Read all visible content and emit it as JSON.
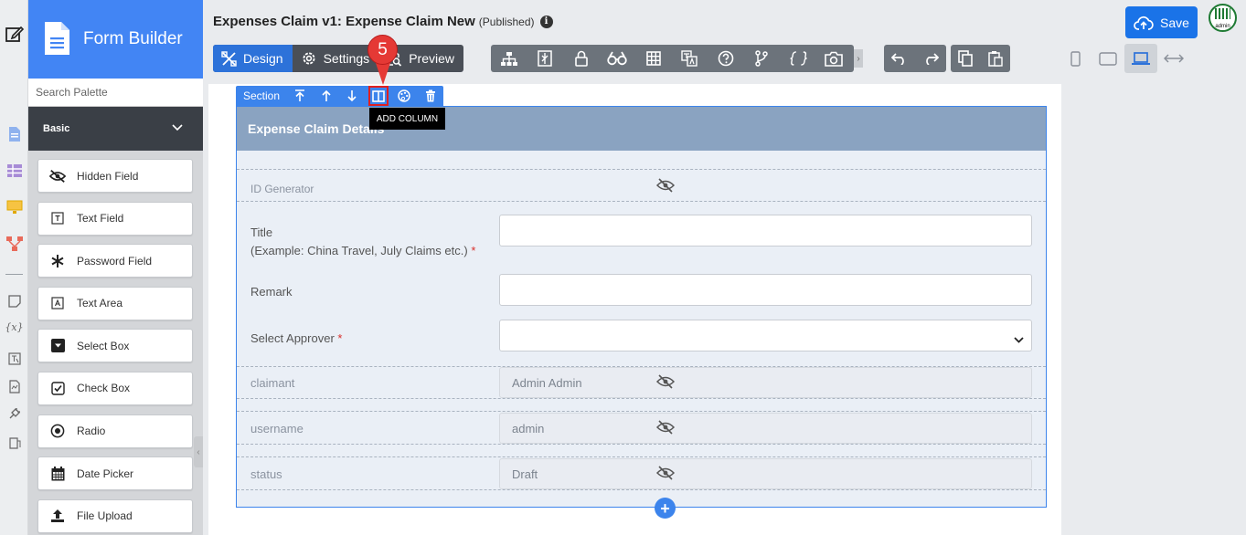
{
  "app": {
    "title": "Expenses Claim v1: Expense Claim New",
    "status": "(Published)"
  },
  "palette": {
    "title": "Form Builder",
    "search_placeholder": "Search Palette",
    "category": "Basic",
    "items": [
      {
        "label": "Hidden Field",
        "icon": "eye-slash-icon"
      },
      {
        "label": "Text Field",
        "icon": "text-field-icon"
      },
      {
        "label": "Password Field",
        "icon": "asterisk-icon"
      },
      {
        "label": "Text Area",
        "icon": "text-area-icon"
      },
      {
        "label": "Select Box",
        "icon": "select-box-icon"
      },
      {
        "label": "Check Box",
        "icon": "checkbox-icon"
      },
      {
        "label": "Radio",
        "icon": "radio-icon"
      },
      {
        "label": "Date Picker",
        "icon": "calendar-icon"
      },
      {
        "label": "File Upload",
        "icon": "upload-icon"
      }
    ]
  },
  "tabs": [
    {
      "label": "Design",
      "icon": "design-icon",
      "active": true
    },
    {
      "label": "Settings",
      "icon": "gear-icon",
      "active": false
    },
    {
      "label": "Preview",
      "icon": "preview-icon",
      "active": false
    }
  ],
  "toolbar": {
    "save_label": "Save"
  },
  "avatar_label": "admin",
  "section_toolbar": {
    "label": "Section",
    "tooltip": "ADD COLUMN"
  },
  "annotation": {
    "step": "5"
  },
  "section": {
    "title": "Expense Claim Details",
    "fields": [
      {
        "label": "ID Generator",
        "hidden": true,
        "value": ""
      },
      {
        "label": "Title",
        "sublabel": "(Example: China Travel, July Claims etc.)",
        "required": true,
        "value": ""
      },
      {
        "label": "Remark",
        "required": false,
        "value": ""
      },
      {
        "label": "Select Approver",
        "required": true,
        "value": ""
      },
      {
        "label": "claimant",
        "hidden": true,
        "value": "Admin Admin"
      },
      {
        "label": "username",
        "hidden": true,
        "value": "admin"
      },
      {
        "label": "status",
        "hidden": true,
        "value": "Draft"
      }
    ]
  },
  "colors": {
    "brand": "#4285f4",
    "active_tab": "#2d72d9",
    "section_border": "#3c84ec",
    "section_header": "#8aa3c1",
    "required": "#d9302c",
    "annotation": "#e53935"
  }
}
